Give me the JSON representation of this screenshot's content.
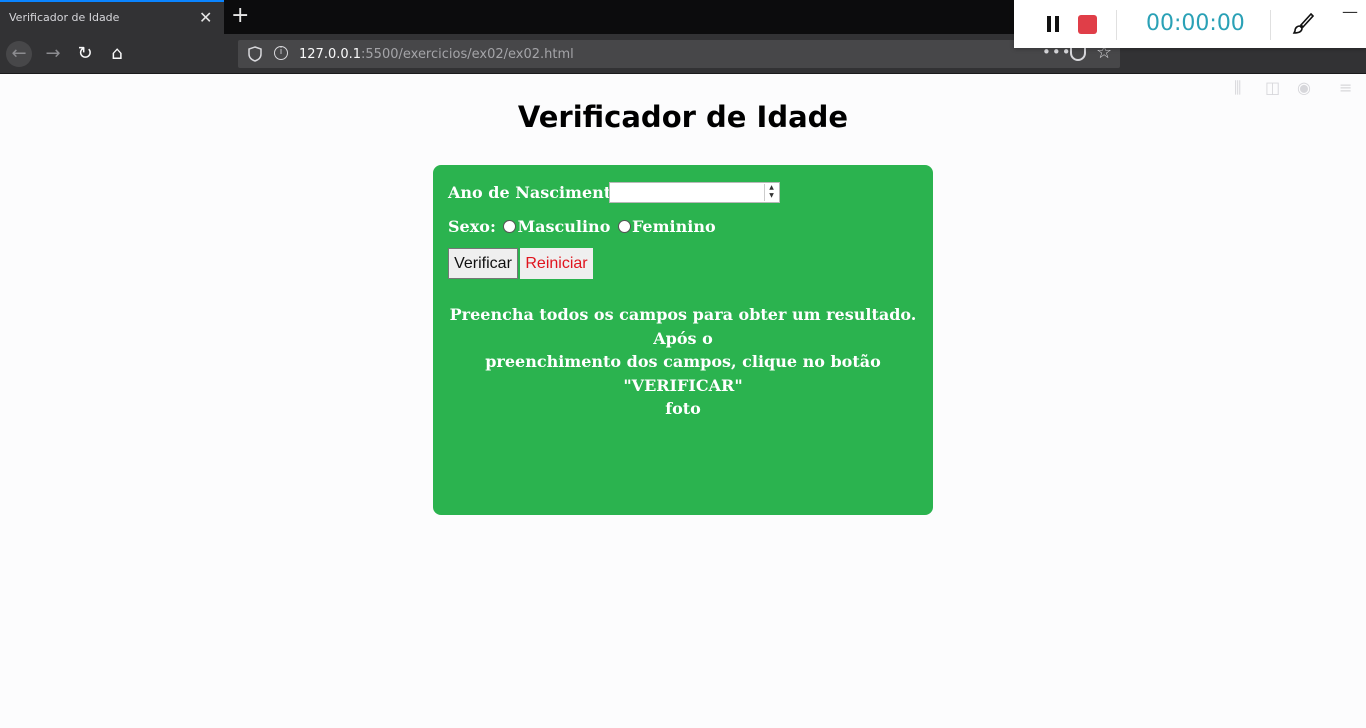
{
  "browser": {
    "tab_title": "Verificador de Idade",
    "url_host": "127.0.0.1",
    "url_rest": ":5500/exercicios/ex02/ex02.html"
  },
  "recorder": {
    "timer": "00:00:00"
  },
  "page": {
    "title": "Verificador de Idade",
    "year_label": "Ano de Nascimento:",
    "year_value": "",
    "sex_label": "Sexo:",
    "sex_options": [
      "Masculino",
      "Feminino"
    ],
    "verify_label": "Verificar",
    "reset_label": "Reiniciar",
    "result_line1": "Preencha todos os campos para obter um resultado. Após o",
    "result_line2": "preenchimento dos campos, clique no botão \"VERIFICAR\"",
    "result_line3": "foto"
  },
  "colors": {
    "panel": "#2bb34f",
    "reset_text": "#e0141e",
    "timer": "#2aa1b6",
    "stop": "#e03e48"
  }
}
